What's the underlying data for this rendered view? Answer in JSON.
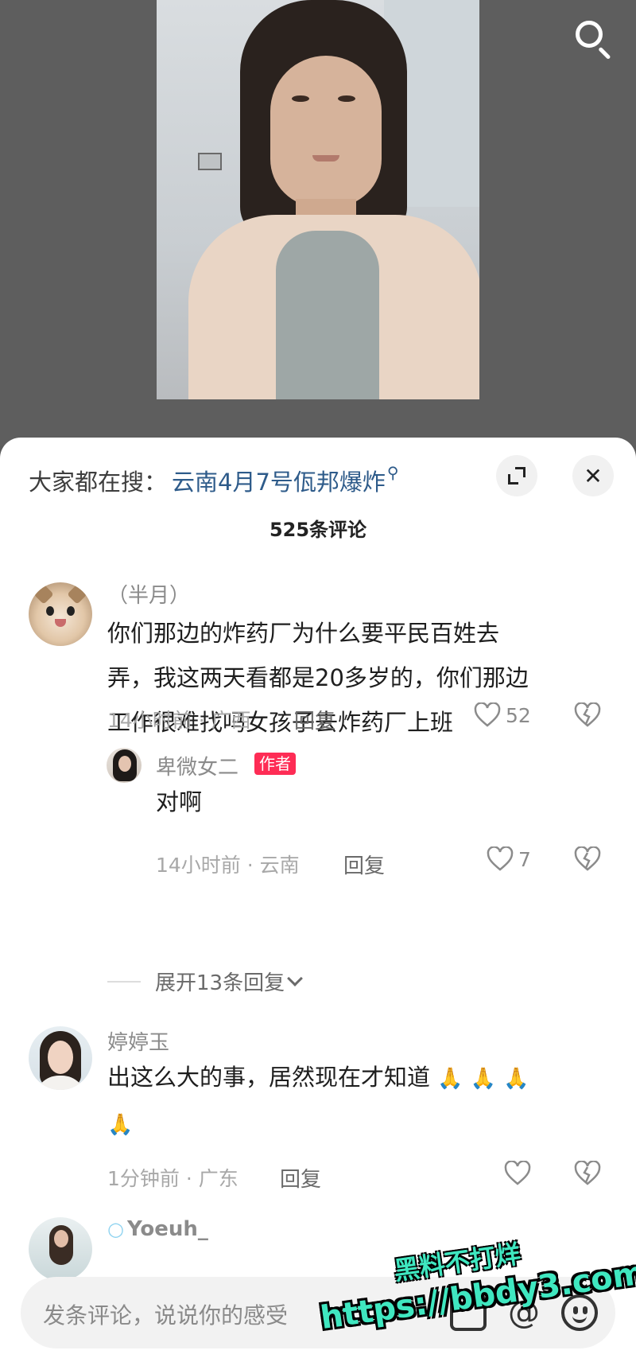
{
  "header": {
    "search_icon": "search-icon"
  },
  "sheet": {
    "hot_label": "大家都在搜：",
    "hot_query": "云南4月7号佤邦爆炸",
    "count_title": "525条评论"
  },
  "comments": [
    {
      "username": "（半月）",
      "text_lines": [
        "你们那边的炸药厂为什么要平民百姓去",
        "弄，我这两天看都是20多岁的，你们那边",
        "工作很难找吗女孩子去炸药厂上班"
      ],
      "meta": "14小时前 · 广西",
      "reply_label": "回复",
      "likes": "52"
    },
    {
      "username": "卑微女二",
      "badge": "作者",
      "text": "对啊",
      "meta": "14小时前 · 云南",
      "reply_label": "回复",
      "likes": "7"
    },
    {
      "expand_label": "展开13条回复"
    },
    {
      "username": "婷婷玉",
      "text_line1": "出这么大的事，居然现在才知道",
      "meta": "1分钟前 · 广东",
      "reply_label": "回复"
    },
    {
      "username": "Yoeuh_"
    }
  ],
  "input": {
    "placeholder": "发条评论，说说你的感受"
  },
  "watermark": {
    "line1": "黑料不打烊",
    "line2": "https://bbdy3.com"
  },
  "colors": {
    "accent": "#fe2c55",
    "link": "#2e5b8a",
    "watermark": "#3fe7c0"
  }
}
